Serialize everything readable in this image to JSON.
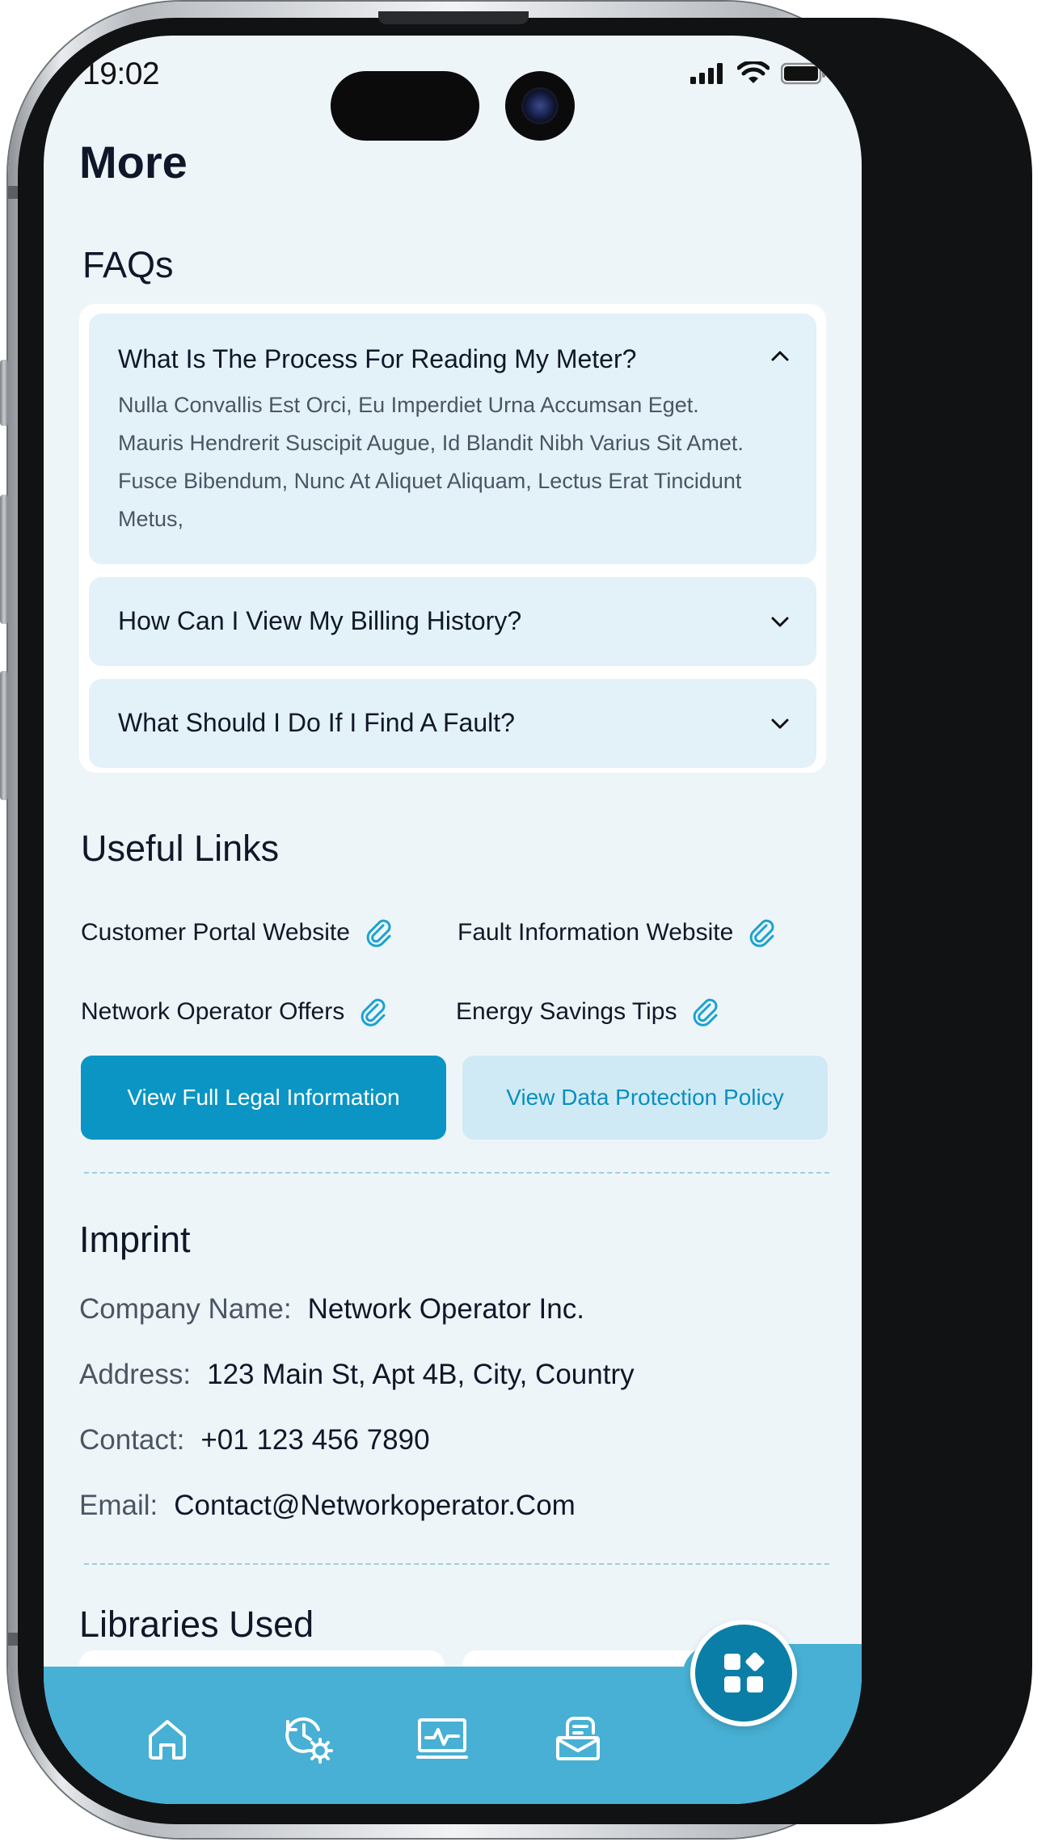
{
  "status_bar": {
    "time": "19:02"
  },
  "page": {
    "title": "More"
  },
  "faqs": {
    "title": "FAQs",
    "items": [
      {
        "question": "What Is The Process For Reading My Meter?",
        "answer_lines": [
          "Nulla Convallis Est Orci, Eu Imperdiet Urna Accumsan Eget.",
          "Mauris Hendrerit Suscipit Augue, Id Blandit Nibh Varius Sit Amet.",
          "Fusce Bibendum, Nunc At Aliquet Aliquam, Lectus Erat Tincidunt",
          "Metus,"
        ],
        "expanded": true
      },
      {
        "question": "How Can I View My Billing History?",
        "expanded": false
      },
      {
        "question": "What Should I Do If I Find A Fault?",
        "expanded": false
      }
    ]
  },
  "useful_links": {
    "title": "Useful Links",
    "items": [
      {
        "label": "Customer Portal Website",
        "icon": "paperclip-icon"
      },
      {
        "label": "Fault Information Website",
        "icon": "paperclip-icon"
      },
      {
        "label": "Network Operator Offers",
        "icon": "paperclip-icon"
      },
      {
        "label": "Energy Savings Tips",
        "icon": "paperclip-icon"
      }
    ]
  },
  "buttons": {
    "legal": "View Full Legal Information",
    "data_protection": "View Data Protection Policy"
  },
  "imprint": {
    "title": "Imprint",
    "rows": [
      {
        "label": "Company Name:",
        "value": "Network Operator Inc."
      },
      {
        "label": "Address:",
        "value": "123 Main St, Apt 4B, City, Country"
      },
      {
        "label": "Contact:",
        "value": "+01 123 456 7890"
      },
      {
        "label": "Email:",
        "value": "Contact@Networkoperator.Com"
      }
    ]
  },
  "libraries": {
    "title": "Libraries Used"
  },
  "bottom_nav": {
    "items": [
      {
        "icon": "home-icon"
      },
      {
        "icon": "history-settings-icon"
      },
      {
        "icon": "monitor-activity-icon"
      },
      {
        "icon": "mailbox-icon"
      }
    ],
    "fab_icon": "apps-grid-icon"
  },
  "colors": {
    "primary": "#0a95c4",
    "secondary_bg": "#d0eaf5",
    "nav_bg": "#47b0d4",
    "fab_bg": "#0a7ea6",
    "screen_bg": "#eef5f9",
    "faq_item_bg": "#e3f1f8"
  }
}
